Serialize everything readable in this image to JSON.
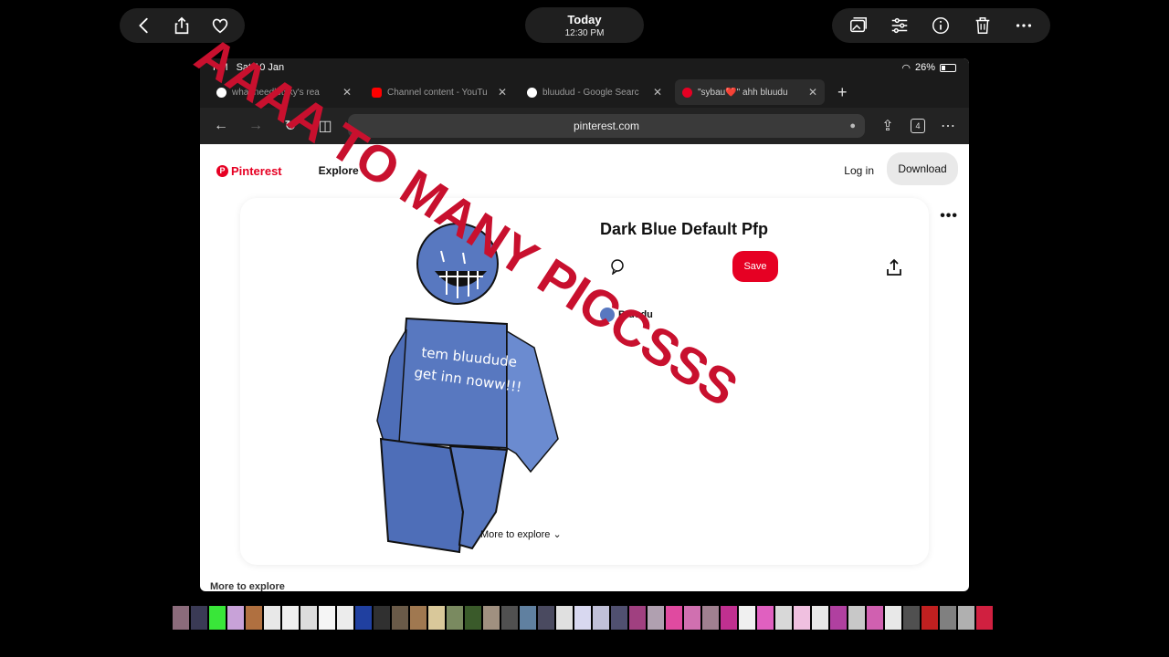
{
  "photos_bar": {
    "date_title": "Today",
    "date_time": "12:30 PM",
    "left_icons": [
      "back-icon",
      "share-icon",
      "heart-icon"
    ],
    "right_icons": [
      "photos-icon",
      "adjust-icon",
      "info-icon",
      "trash-icon",
      "more-icon"
    ]
  },
  "ipad": {
    "status_time": "PM",
    "status_date": "Sat 10 Jan",
    "battery": "26%",
    "tabs": [
      {
        "title": "what needletsky's rea",
        "color": "#ffffff"
      },
      {
        "title": "Channel content - YouTu",
        "color": "#ff0000"
      },
      {
        "title": "bluudud - Google Searc",
        "color": "#ffffff"
      },
      {
        "title": "\"sybau❤️\" ahh bluudu",
        "color": "#e60023"
      }
    ],
    "url": "pinterest.com",
    "tab_count": "4"
  },
  "pinterest": {
    "logo": "Pinterest",
    "explore": "Explore",
    "login": "Log in",
    "download": "Download",
    "pin_title": "Dark Blue Default Pfp",
    "save": "Save",
    "author": "Bluudu",
    "drawing_text_line1": "tem bluudude",
    "drawing_text_line2": "get inn noww!!!",
    "more_to_explore": "More to explore",
    "more_to_explore_bottom": "More to explore",
    "more_dots": "•••"
  },
  "overlay_text": "AAAA TO MANY PICCSSS",
  "colors": {
    "pinterest_red": "#e60023",
    "overlay_red": "#c8102e",
    "character_blue": "#5878c0"
  },
  "thumbnail_colors": [
    "#8b6b7b",
    "#3a3a55",
    "#39e639",
    "#c8a2d8",
    "#b07040",
    "#e8e8e8",
    "#f0f0f0",
    "#dcdcdc",
    "#f5f5f5",
    "#ececec",
    "#2040a0",
    "#303030",
    "#6a5a48",
    "#a07850",
    "#d9c89a",
    "#7a8a60",
    "#3a5a2a",
    "#a09080",
    "#505050",
    "#6080a0",
    "#4a4a60",
    "#e0e0e0",
    "#d8d8f0",
    "#c0c0d8",
    "#505070",
    "#a04080",
    "#b0a0b0",
    "#e04aa0",
    "#d070b0",
    "#a08090",
    "#c03090",
    "#f0f0f0",
    "#e060c0",
    "#d8d8d8",
    "#f0c0e0",
    "#e8e8e8",
    "#b040a0",
    "#c8c8c8",
    "#d060b0",
    "#e8e8e8",
    "#505050",
    "#c02020",
    "#808080",
    "#b0b0b0",
    "#d02040"
  ]
}
